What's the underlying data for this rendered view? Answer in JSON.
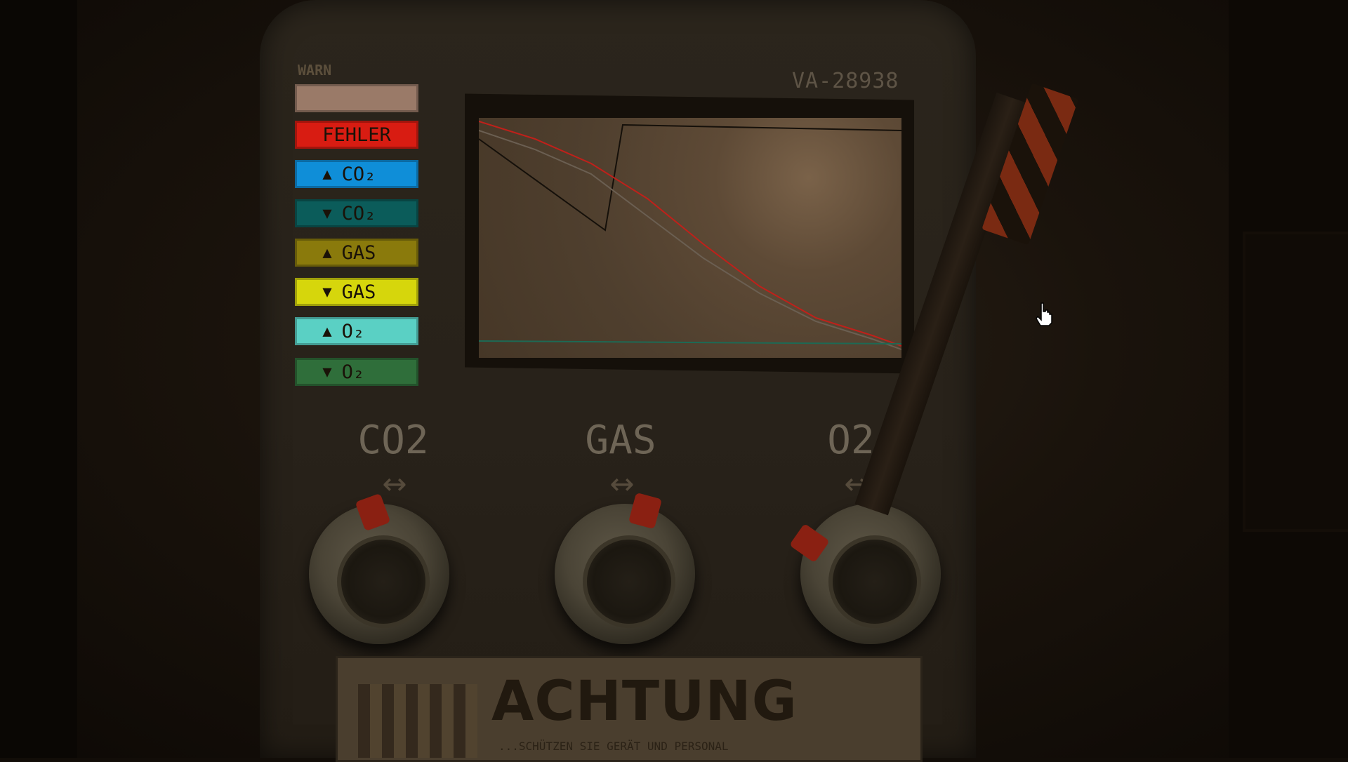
{
  "device": {
    "serial": "VA-28938",
    "warn_label": "WARN"
  },
  "indicators": [
    {
      "label": "",
      "arrow": "",
      "color": "#9a7a68"
    },
    {
      "label": "FEHLER",
      "arrow": "",
      "color": "#d81c12"
    },
    {
      "label": "CO₂",
      "arrow": "▲",
      "color": "#0f8ed8"
    },
    {
      "label": "CO₂",
      "arrow": "▼",
      "color": "#0b5c5a"
    },
    {
      "label": "GAS",
      "arrow": "▲",
      "color": "#8a7a0c"
    },
    {
      "label": "GAS",
      "arrow": "▼",
      "color": "#d6d60c"
    },
    {
      "label": "O₂",
      "arrow": "▲",
      "color": "#5ad0c4"
    },
    {
      "label": "O₂",
      "arrow": "▼",
      "color": "#2f6e3a"
    }
  ],
  "knobs": [
    {
      "label": "CO2",
      "arrow": "↔"
    },
    {
      "label": "GAS",
      "arrow": "↔"
    },
    {
      "label": "O2",
      "arrow": "↔"
    }
  ],
  "warning": {
    "title": "ACHTUNG",
    "subtitle": "...SCHÜTZEN SIE GERÄT UND PERSONAL"
  },
  "graph": {
    "traces": [
      {
        "name": "red",
        "color": "#c0201a"
      },
      {
        "name": "gray",
        "color": "#6b5f52"
      },
      {
        "name": "black",
        "color": "#15100a"
      },
      {
        "name": "green",
        "color": "#1d6a55"
      }
    ]
  }
}
